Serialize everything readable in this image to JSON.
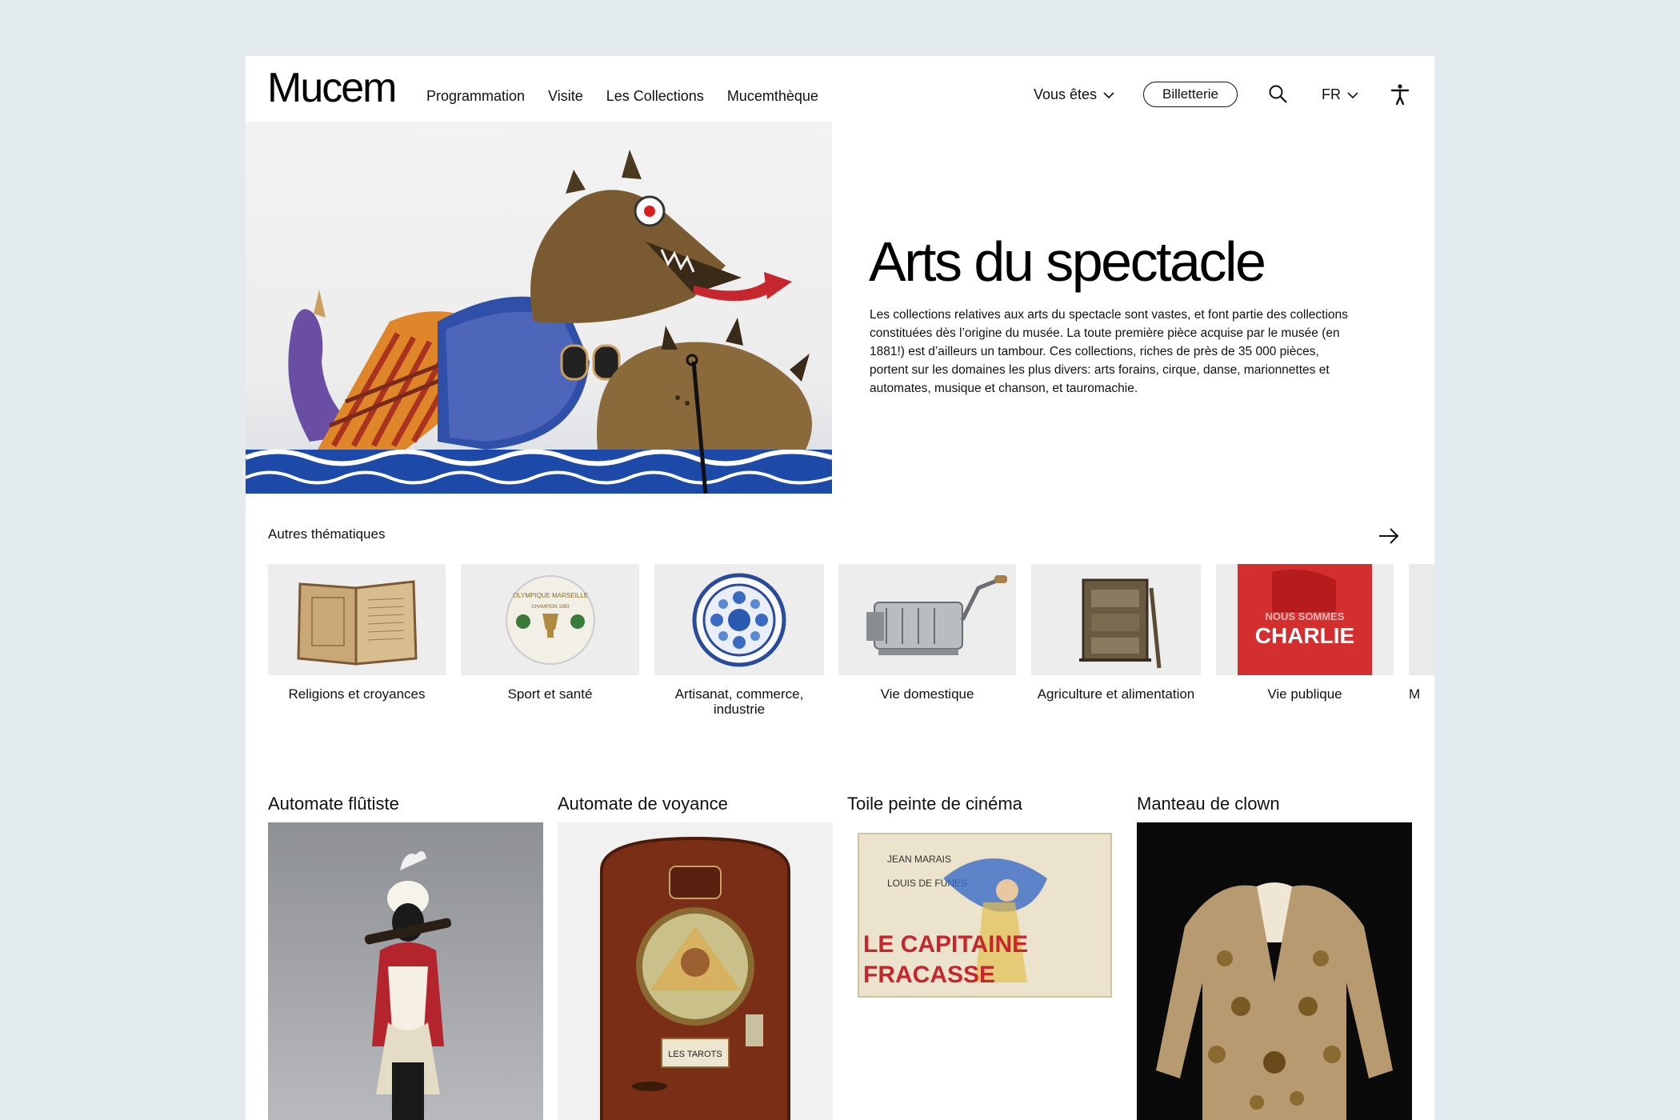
{
  "header": {
    "logo": "Mucem",
    "nav": [
      "Programmation",
      "Visite",
      "Les Collections",
      "Mucemthèque"
    ],
    "vous_etes": "Vous êtes",
    "billetterie": "Billetterie",
    "lang": "FR"
  },
  "hero": {
    "title": "Arts du spectacle",
    "description": "Les collections relatives aux arts du spectacle sont vastes, et font partie des collections constituées dès l’origine du musée. La toute première pièce acquise par le musée (en 1881!) est d’ailleurs un tambour. Ces collections, riches de près de 35 000 pièces, portent sur les domaines les plus divers: arts forains, cirque, danse, marionnettes et automates, musique et chanson, et tauromachie."
  },
  "themes": {
    "title": "Autres thématiques",
    "items": [
      {
        "label": "Religions et croyances"
      },
      {
        "label": "Sport et santé",
        "ball_text": "OLYMPIQUE MARSEILLE",
        "ball_sub": "CHAMPION 1993"
      },
      {
        "label": "Artisanat, commerce, industrie"
      },
      {
        "label": "Vie domestique"
      },
      {
        "label": "Agriculture et alimentation"
      },
      {
        "label": "Vie publique",
        "poster_top": "NOUS SOMMES",
        "poster_main": "CHARLIE"
      },
      {
        "label": "M"
      }
    ]
  },
  "objects": [
    {
      "title": "Automate flûtiste"
    },
    {
      "title": "Automate de voyance",
      "plate": "LES TAROTS"
    },
    {
      "title": "Toile peinte de cinéma",
      "actor1": "JEAN MARAIS",
      "actor2": "LOUIS DE FUNES",
      "film_line1": "LE CAPITAINE",
      "film_line2": "FRACASSE"
    },
    {
      "title": "Manteau de clown"
    }
  ],
  "colors": {
    "background": "#e3ebee",
    "page": "#ffffff",
    "charlie_red": "#d32f2f"
  }
}
